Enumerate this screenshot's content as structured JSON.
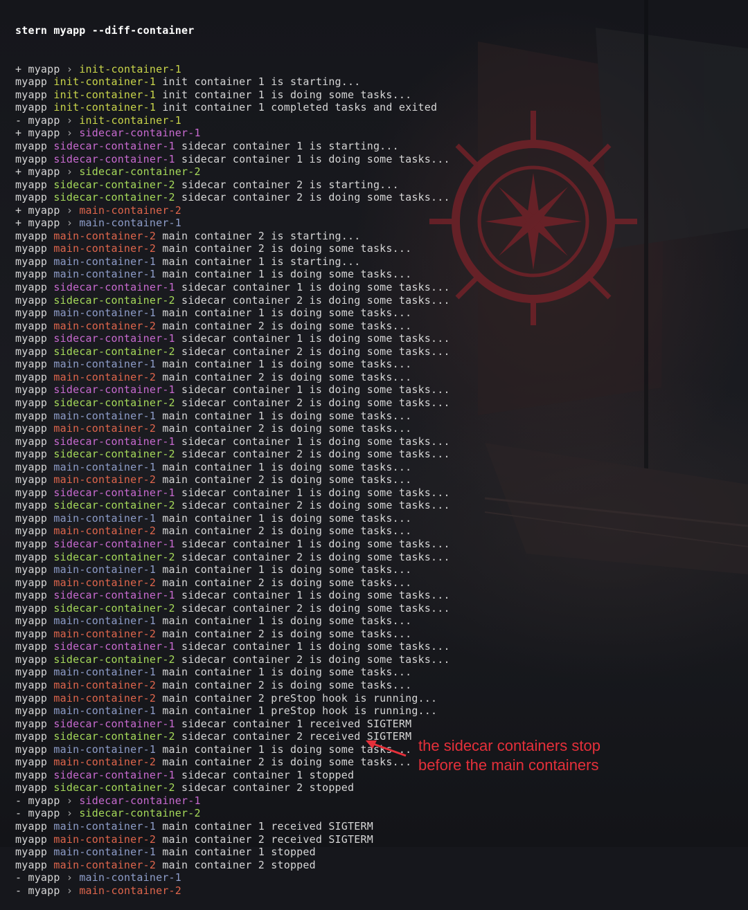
{
  "command": "stern myapp --diff-container",
  "palette": {
    "init": "#c9d54a",
    "sidecar_1": "#c86ad0",
    "sidecar_2": "#a6da5a",
    "main_1": "#8e9dc9",
    "main_2": "#e0664c",
    "annotation": "#e5303a"
  },
  "lines": [
    {
      "t": "ev",
      "s": "+",
      "p": "myapp",
      "sep": "›",
      "c": "init-container-1",
      "k": "init"
    },
    {
      "t": "log",
      "p": "myapp",
      "c": "init-container-1",
      "k": "init",
      "m": "init container 1 is starting..."
    },
    {
      "t": "log",
      "p": "myapp",
      "c": "init-container-1",
      "k": "init",
      "m": "init container 1 is doing some tasks..."
    },
    {
      "t": "log",
      "p": "myapp",
      "c": "init-container-1",
      "k": "init",
      "m": "init container 1 completed tasks and exited"
    },
    {
      "t": "ev",
      "s": "-",
      "p": "myapp",
      "sep": "›",
      "c": "init-container-1",
      "k": "init"
    },
    {
      "t": "ev",
      "s": "+",
      "p": "myapp",
      "sep": "›",
      "c": "sidecar-container-1",
      "k": "sidecar-1"
    },
    {
      "t": "log",
      "p": "myapp",
      "c": "sidecar-container-1",
      "k": "sidecar-1",
      "m": "sidecar container 1 is starting..."
    },
    {
      "t": "log",
      "p": "myapp",
      "c": "sidecar-container-1",
      "k": "sidecar-1",
      "m": "sidecar container 1 is doing some tasks..."
    },
    {
      "t": "ev",
      "s": "+",
      "p": "myapp",
      "sep": "›",
      "c": "sidecar-container-2",
      "k": "sidecar-2"
    },
    {
      "t": "log",
      "p": "myapp",
      "c": "sidecar-container-2",
      "k": "sidecar-2",
      "m": "sidecar container 2 is starting..."
    },
    {
      "t": "log",
      "p": "myapp",
      "c": "sidecar-container-2",
      "k": "sidecar-2",
      "m": "sidecar container 2 is doing some tasks..."
    },
    {
      "t": "ev",
      "s": "+",
      "p": "myapp",
      "sep": "›",
      "c": "main-container-2",
      "k": "main-2"
    },
    {
      "t": "ev",
      "s": "+",
      "p": "myapp",
      "sep": "›",
      "c": "main-container-1",
      "k": "main-1"
    },
    {
      "t": "log",
      "p": "myapp",
      "c": "main-container-2",
      "k": "main-2",
      "m": "main container 2 is starting..."
    },
    {
      "t": "log",
      "p": "myapp",
      "c": "main-container-2",
      "k": "main-2",
      "m": "main container 2 is doing some tasks..."
    },
    {
      "t": "log",
      "p": "myapp",
      "c": "main-container-1",
      "k": "main-1",
      "m": "main container 1 is starting..."
    },
    {
      "t": "log",
      "p": "myapp",
      "c": "main-container-1",
      "k": "main-1",
      "m": "main container 1 is doing some tasks..."
    },
    {
      "t": "log",
      "p": "myapp",
      "c": "sidecar-container-1",
      "k": "sidecar-1",
      "m": "sidecar container 1 is doing some tasks..."
    },
    {
      "t": "log",
      "p": "myapp",
      "c": "sidecar-container-2",
      "k": "sidecar-2",
      "m": "sidecar container 2 is doing some tasks..."
    },
    {
      "t": "log",
      "p": "myapp",
      "c": "main-container-1",
      "k": "main-1",
      "m": "main container 1 is doing some tasks..."
    },
    {
      "t": "log",
      "p": "myapp",
      "c": "main-container-2",
      "k": "main-2",
      "m": "main container 2 is doing some tasks..."
    },
    {
      "t": "log",
      "p": "myapp",
      "c": "sidecar-container-1",
      "k": "sidecar-1",
      "m": "sidecar container 1 is doing some tasks..."
    },
    {
      "t": "log",
      "p": "myapp",
      "c": "sidecar-container-2",
      "k": "sidecar-2",
      "m": "sidecar container 2 is doing some tasks..."
    },
    {
      "t": "log",
      "p": "myapp",
      "c": "main-container-1",
      "k": "main-1",
      "m": "main container 1 is doing some tasks..."
    },
    {
      "t": "log",
      "p": "myapp",
      "c": "main-container-2",
      "k": "main-2",
      "m": "main container 2 is doing some tasks..."
    },
    {
      "t": "log",
      "p": "myapp",
      "c": "sidecar-container-1",
      "k": "sidecar-1",
      "m": "sidecar container 1 is doing some tasks..."
    },
    {
      "t": "log",
      "p": "myapp",
      "c": "sidecar-container-2",
      "k": "sidecar-2",
      "m": "sidecar container 2 is doing some tasks..."
    },
    {
      "t": "log",
      "p": "myapp",
      "c": "main-container-1",
      "k": "main-1",
      "m": "main container 1 is doing some tasks..."
    },
    {
      "t": "log",
      "p": "myapp",
      "c": "main-container-2",
      "k": "main-2",
      "m": "main container 2 is doing some tasks..."
    },
    {
      "t": "log",
      "p": "myapp",
      "c": "sidecar-container-1",
      "k": "sidecar-1",
      "m": "sidecar container 1 is doing some tasks..."
    },
    {
      "t": "log",
      "p": "myapp",
      "c": "sidecar-container-2",
      "k": "sidecar-2",
      "m": "sidecar container 2 is doing some tasks..."
    },
    {
      "t": "log",
      "p": "myapp",
      "c": "main-container-1",
      "k": "main-1",
      "m": "main container 1 is doing some tasks..."
    },
    {
      "t": "log",
      "p": "myapp",
      "c": "main-container-2",
      "k": "main-2",
      "m": "main container 2 is doing some tasks..."
    },
    {
      "t": "log",
      "p": "myapp",
      "c": "sidecar-container-1",
      "k": "sidecar-1",
      "m": "sidecar container 1 is doing some tasks..."
    },
    {
      "t": "log",
      "p": "myapp",
      "c": "sidecar-container-2",
      "k": "sidecar-2",
      "m": "sidecar container 2 is doing some tasks..."
    },
    {
      "t": "log",
      "p": "myapp",
      "c": "main-container-1",
      "k": "main-1",
      "m": "main container 1 is doing some tasks..."
    },
    {
      "t": "log",
      "p": "myapp",
      "c": "main-container-2",
      "k": "main-2",
      "m": "main container 2 is doing some tasks..."
    },
    {
      "t": "log",
      "p": "myapp",
      "c": "sidecar-container-1",
      "k": "sidecar-1",
      "m": "sidecar container 1 is doing some tasks..."
    },
    {
      "t": "log",
      "p": "myapp",
      "c": "sidecar-container-2",
      "k": "sidecar-2",
      "m": "sidecar container 2 is doing some tasks..."
    },
    {
      "t": "log",
      "p": "myapp",
      "c": "main-container-1",
      "k": "main-1",
      "m": "main container 1 is doing some tasks..."
    },
    {
      "t": "log",
      "p": "myapp",
      "c": "main-container-2",
      "k": "main-2",
      "m": "main container 2 is doing some tasks..."
    },
    {
      "t": "log",
      "p": "myapp",
      "c": "sidecar-container-1",
      "k": "sidecar-1",
      "m": "sidecar container 1 is doing some tasks..."
    },
    {
      "t": "log",
      "p": "myapp",
      "c": "sidecar-container-2",
      "k": "sidecar-2",
      "m": "sidecar container 2 is doing some tasks..."
    },
    {
      "t": "log",
      "p": "myapp",
      "c": "main-container-1",
      "k": "main-1",
      "m": "main container 1 is doing some tasks..."
    },
    {
      "t": "log",
      "p": "myapp",
      "c": "main-container-2",
      "k": "main-2",
      "m": "main container 2 is doing some tasks..."
    },
    {
      "t": "log",
      "p": "myapp",
      "c": "sidecar-container-1",
      "k": "sidecar-1",
      "m": "sidecar container 1 is doing some tasks..."
    },
    {
      "t": "log",
      "p": "myapp",
      "c": "sidecar-container-2",
      "k": "sidecar-2",
      "m": "sidecar container 2 is doing some tasks..."
    },
    {
      "t": "log",
      "p": "myapp",
      "c": "main-container-1",
      "k": "main-1",
      "m": "main container 1 is doing some tasks..."
    },
    {
      "t": "log",
      "p": "myapp",
      "c": "main-container-2",
      "k": "main-2",
      "m": "main container 2 is doing some tasks..."
    },
    {
      "t": "log",
      "p": "myapp",
      "c": "main-container-2",
      "k": "main-2",
      "m": "main container 2 preStop hook is running..."
    },
    {
      "t": "log",
      "p": "myapp",
      "c": "main-container-1",
      "k": "main-1",
      "m": "main container 1 preStop hook is running..."
    },
    {
      "t": "log",
      "p": "myapp",
      "c": "sidecar-container-1",
      "k": "sidecar-1",
      "m": "sidecar container 1 received SIGTERM"
    },
    {
      "t": "log",
      "p": "myapp",
      "c": "sidecar-container-2",
      "k": "sidecar-2",
      "m": "sidecar container 2 received SIGTERM"
    },
    {
      "t": "log",
      "p": "myapp",
      "c": "main-container-1",
      "k": "main-1",
      "m": "main container 1 is doing some tasks..."
    },
    {
      "t": "log",
      "p": "myapp",
      "c": "main-container-2",
      "k": "main-2",
      "m": "main container 2 is doing some tasks..."
    },
    {
      "t": "log",
      "p": "myapp",
      "c": "sidecar-container-1",
      "k": "sidecar-1",
      "m": "sidecar container 1 stopped"
    },
    {
      "t": "log",
      "p": "myapp",
      "c": "sidecar-container-2",
      "k": "sidecar-2",
      "m": "sidecar container 2 stopped"
    },
    {
      "t": "ev",
      "s": "-",
      "p": "myapp",
      "sep": "›",
      "c": "sidecar-container-1",
      "k": "sidecar-1"
    },
    {
      "t": "ev",
      "s": "-",
      "p": "myapp",
      "sep": "›",
      "c": "sidecar-container-2",
      "k": "sidecar-2"
    },
    {
      "t": "log",
      "p": "myapp",
      "c": "main-container-1",
      "k": "main-1",
      "m": "main container 1 received SIGTERM"
    },
    {
      "t": "log",
      "p": "myapp",
      "c": "main-container-2",
      "k": "main-2",
      "m": "main container 2 received SIGTERM"
    },
    {
      "t": "log",
      "p": "myapp",
      "c": "main-container-1",
      "k": "main-1",
      "m": "main container 1 stopped"
    },
    {
      "t": "log",
      "p": "myapp",
      "c": "main-container-2",
      "k": "main-2",
      "m": "main container 2 stopped"
    },
    {
      "t": "ev",
      "s": "-",
      "p": "myapp",
      "sep": "›",
      "c": "main-container-1",
      "k": "main-1"
    },
    {
      "t": "ev",
      "s": "-",
      "p": "myapp",
      "sep": "›",
      "c": "main-container-2",
      "k": "main-2"
    }
  ],
  "annotation": {
    "line1": "the sidecar containers stop",
    "line2": "before the main containers"
  }
}
